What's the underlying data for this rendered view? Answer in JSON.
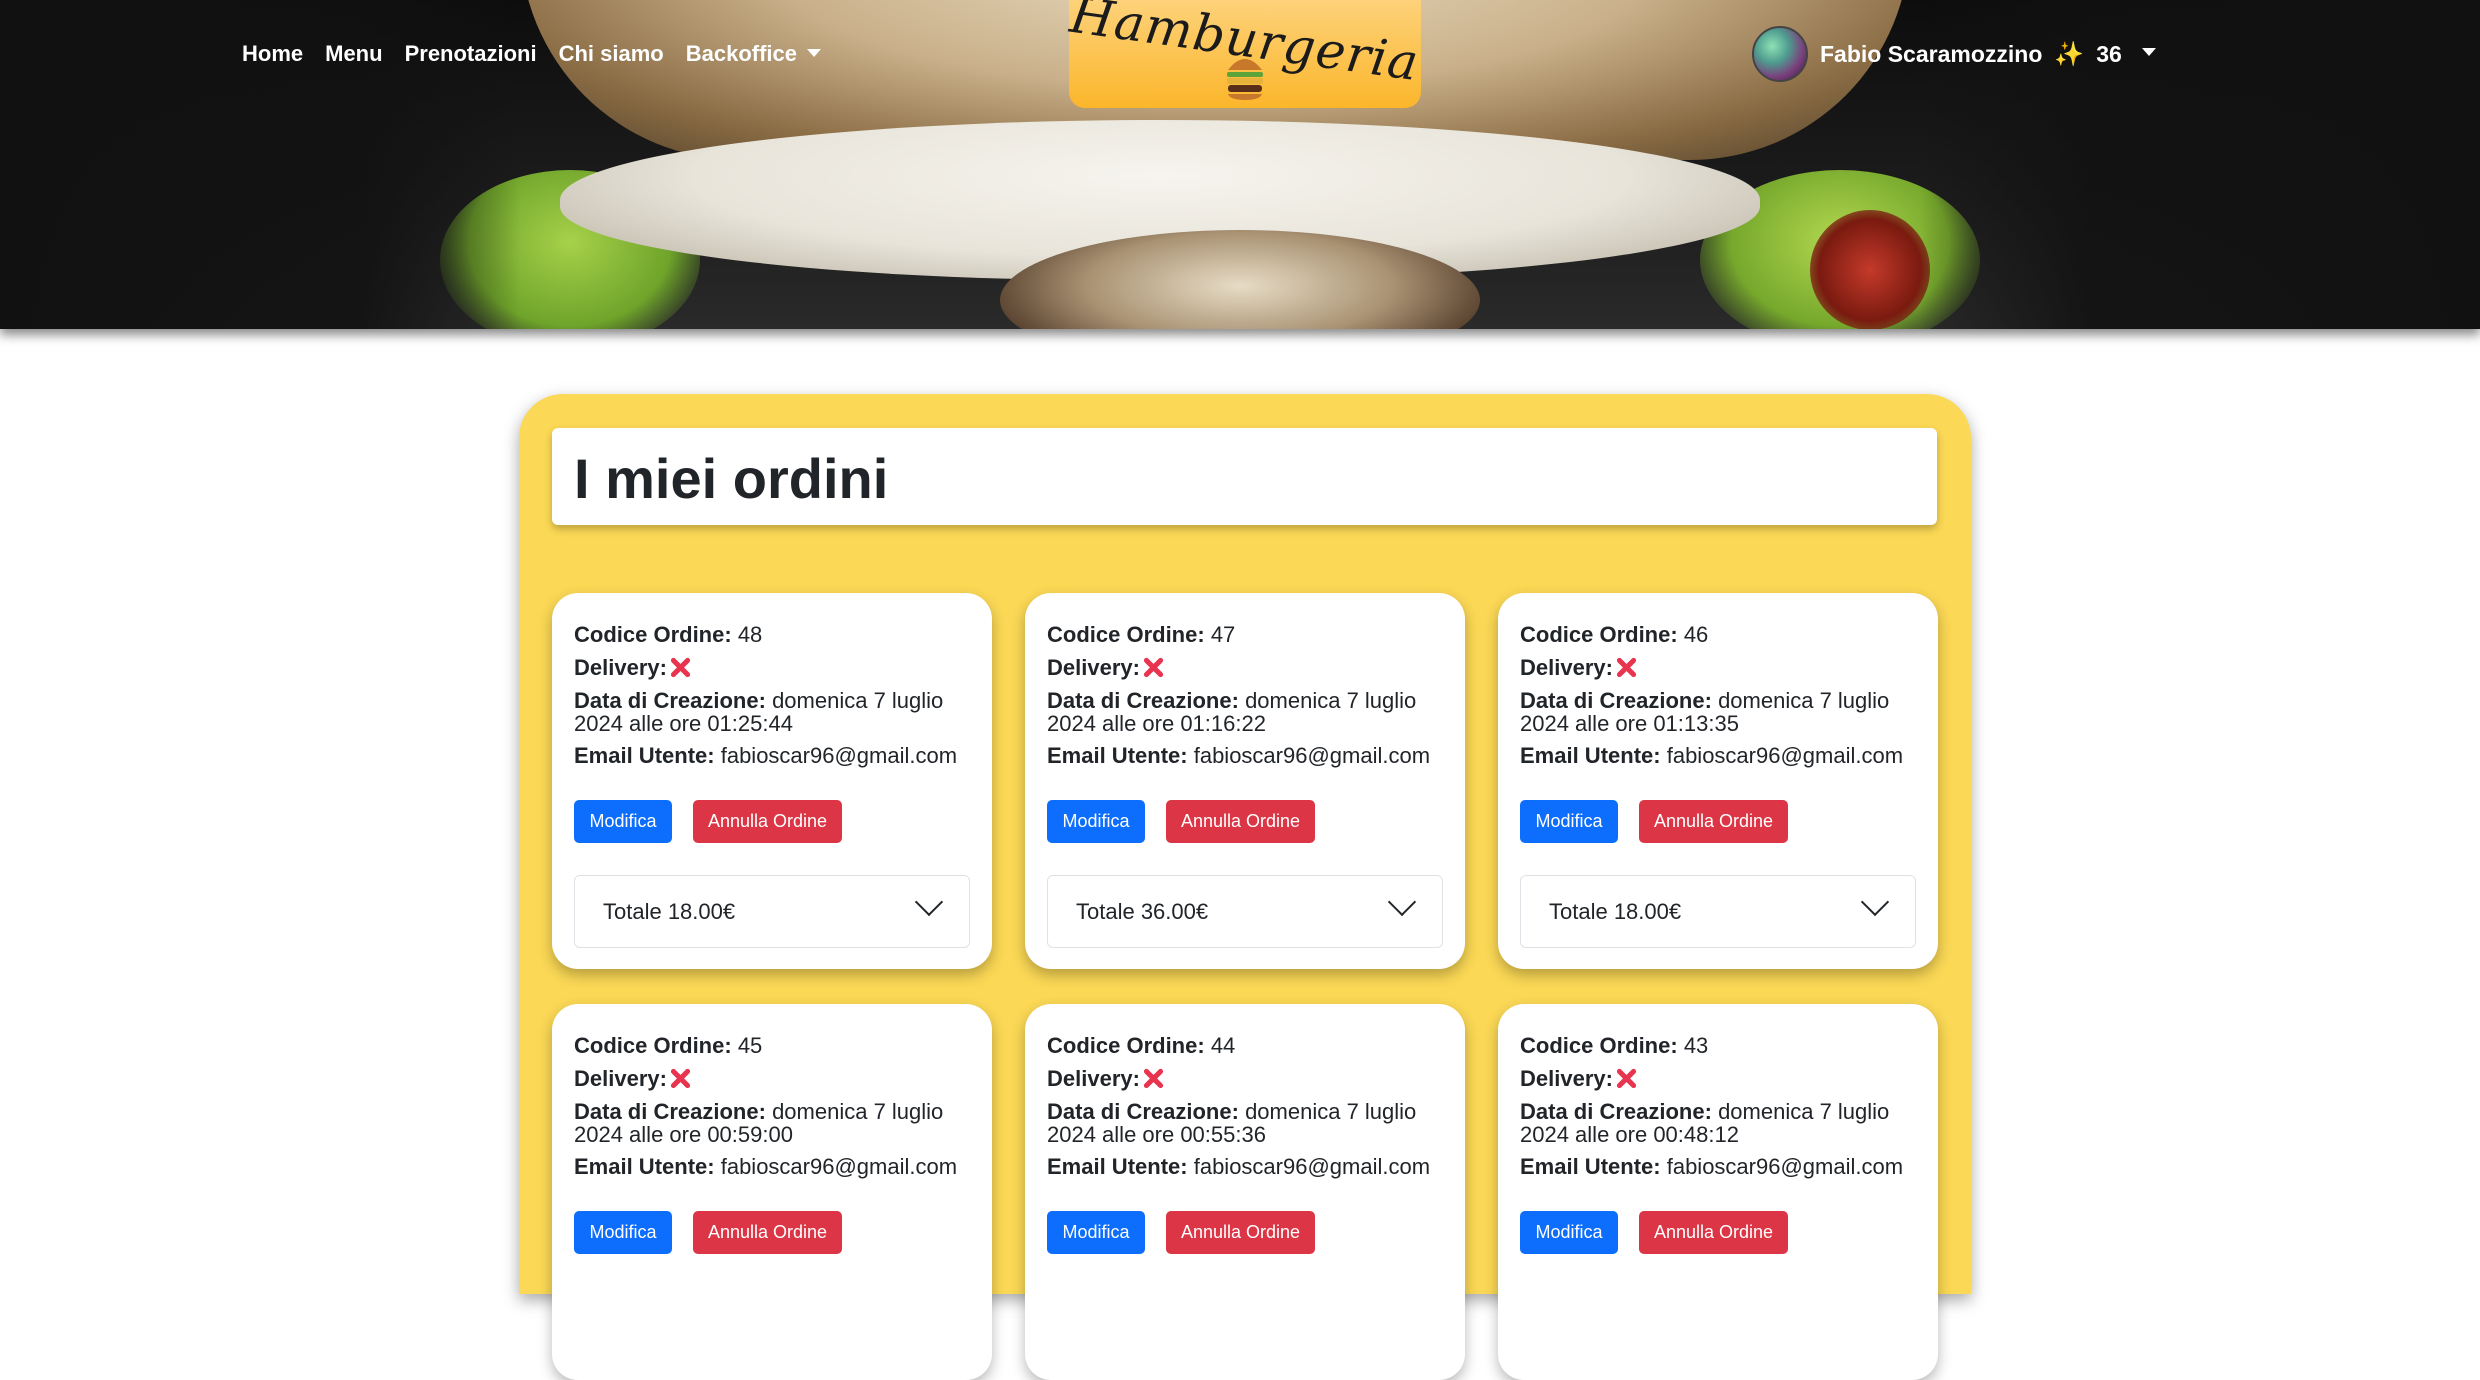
{
  "nav": {
    "home": "Home",
    "menu": "Menu",
    "prenotazioni": "Prenotazioni",
    "chi_siamo": "Chi siamo",
    "backoffice": "Backoffice"
  },
  "logo": {
    "text": "Hamburgeria"
  },
  "user": {
    "name": "Fabio Scaramozzino",
    "sparkle": "✨",
    "points": "36"
  },
  "page": {
    "title": "I miei ordini"
  },
  "labels": {
    "code": "Codice Ordine:",
    "delivery": "Delivery:",
    "created": "Data di Creazione:",
    "email": "Email Utente:",
    "edit": "Modifica",
    "cancel": "Annulla Ordine"
  },
  "orders": [
    {
      "code": "48",
      "delivery": false,
      "date_line1": "domenica 7 luglio",
      "date_line2": "2024 alle ore 01:25:44",
      "email": "fabioscar96@gmail.com",
      "total": "Totale 18.00€"
    },
    {
      "code": "47",
      "delivery": false,
      "date_line1": "domenica 7 luglio",
      "date_line2": "2024 alle ore 01:16:22",
      "email": "fabioscar96@gmail.com",
      "total": "Totale 36.00€"
    },
    {
      "code": "46",
      "delivery": false,
      "date_line1": "domenica 7 luglio",
      "date_line2": "2024 alle ore 01:13:35",
      "email": "fabioscar96@gmail.com",
      "total": "Totale 18.00€"
    },
    {
      "code": "45",
      "delivery": false,
      "date_line1": "domenica 7 luglio",
      "date_line2": "2024 alle ore 00:59:00",
      "email": "fabioscar96@gmail.com",
      "total": ""
    },
    {
      "code": "44",
      "delivery": false,
      "date_line1": "domenica 7 luglio",
      "date_line2": "2024 alle ore 00:55:36",
      "email": "fabioscar96@gmail.com",
      "total": ""
    },
    {
      "code": "43",
      "delivery": false,
      "date_line1": "domenica 7 luglio",
      "date_line2": "2024 alle ore 00:48:12",
      "email": "fabioscar96@gmail.com",
      "total": ""
    }
  ],
  "colors": {
    "panel": "#fbd855",
    "edit": "#0d6efd",
    "cancel": "#dc3545",
    "logo": "#fbb62b"
  }
}
